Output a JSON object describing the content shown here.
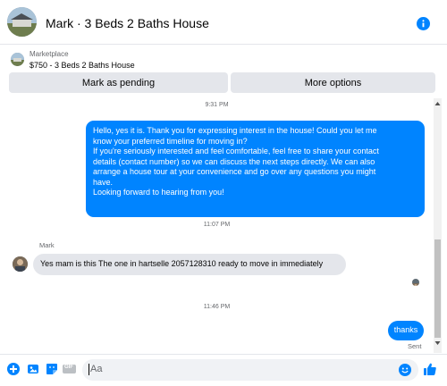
{
  "header": {
    "title": "Mark · 3 Beds 2 Baths House",
    "avatar_icon": "house-photo-avatar",
    "info_icon": "info-icon"
  },
  "marketplace": {
    "label": "Marketplace",
    "listing": "$750 - 3 Beds 2 Baths House",
    "buttons": {
      "mark_pending": "Mark as pending",
      "more_options": "More options"
    }
  },
  "messages": {
    "ts1": "9:31 PM",
    "outgoing1": {
      "lines": [
        "Hello, yes it is. Thank you for expressing interest in the house! Could you let me",
        "know your preferred timeline for moving in?",
        "If you're seriously interested and feel comfortable, feel free to share your contact",
        "details (contact number) so we can discuss the next steps directly. We can also",
        "arrange a house tour at your convenience and go over any questions you might",
        "have.",
        "Looking forward to hearing from you!"
      ]
    },
    "ts2": "11:07 PM",
    "incoming1": {
      "sender": "Mark",
      "text": "Yes mam is this The one in hartselle 2057128310 ready to move in immediately"
    },
    "ts3": "11:46 PM",
    "outgoing2": {
      "text": "thanks",
      "status": "Sent"
    }
  },
  "composer": {
    "placeholder": "Aa",
    "icons": [
      "plus-circle-icon",
      "photo-icon",
      "sticker-icon",
      "gif-icon",
      "emoji-icon",
      "thumbs-up-icon"
    ],
    "gif_text": "GIF"
  },
  "colors": {
    "accent": "#0084ff",
    "bubble_in": "#e4e6eb",
    "muted_text": "#65676b"
  }
}
